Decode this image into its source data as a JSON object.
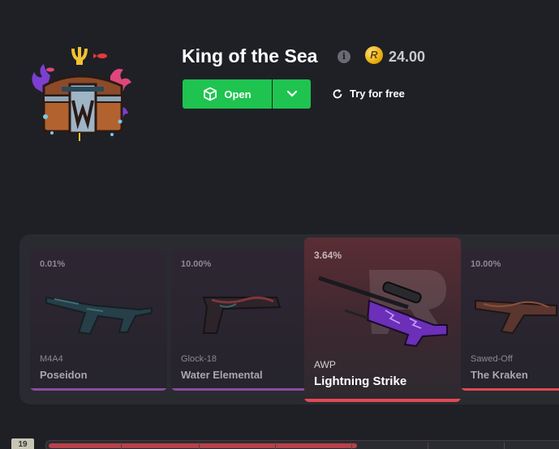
{
  "case": {
    "title": "King of the Sea",
    "price": "24.00",
    "coin_symbol": "R",
    "info_symbol": "i"
  },
  "actions": {
    "open_label": "Open",
    "try_free_label": "Try for free"
  },
  "items": [
    {
      "percent": "0.01%",
      "type": "M4A4",
      "name": "Poseidon",
      "rarity_color": "#8b4aa6"
    },
    {
      "percent": "10.00%",
      "type": "Glock-18",
      "name": "Water Elemental",
      "rarity_color": "#8b4aa6"
    },
    {
      "percent": "3.64%",
      "type": "AWP",
      "name": "Lightning Strike",
      "rarity_color": "#e04a52",
      "featured": true
    },
    {
      "percent": "10.00%",
      "type": "Sawed-Off",
      "name": "The Kraken",
      "rarity_color": "#e04a52"
    }
  ],
  "footer": {
    "round": "19",
    "progress": 0.6
  },
  "colors": {
    "accent_green": "#1ec44f",
    "background": "#1f2026",
    "covert_red": "#e04a52",
    "classified_purple": "#8b4aa6"
  }
}
